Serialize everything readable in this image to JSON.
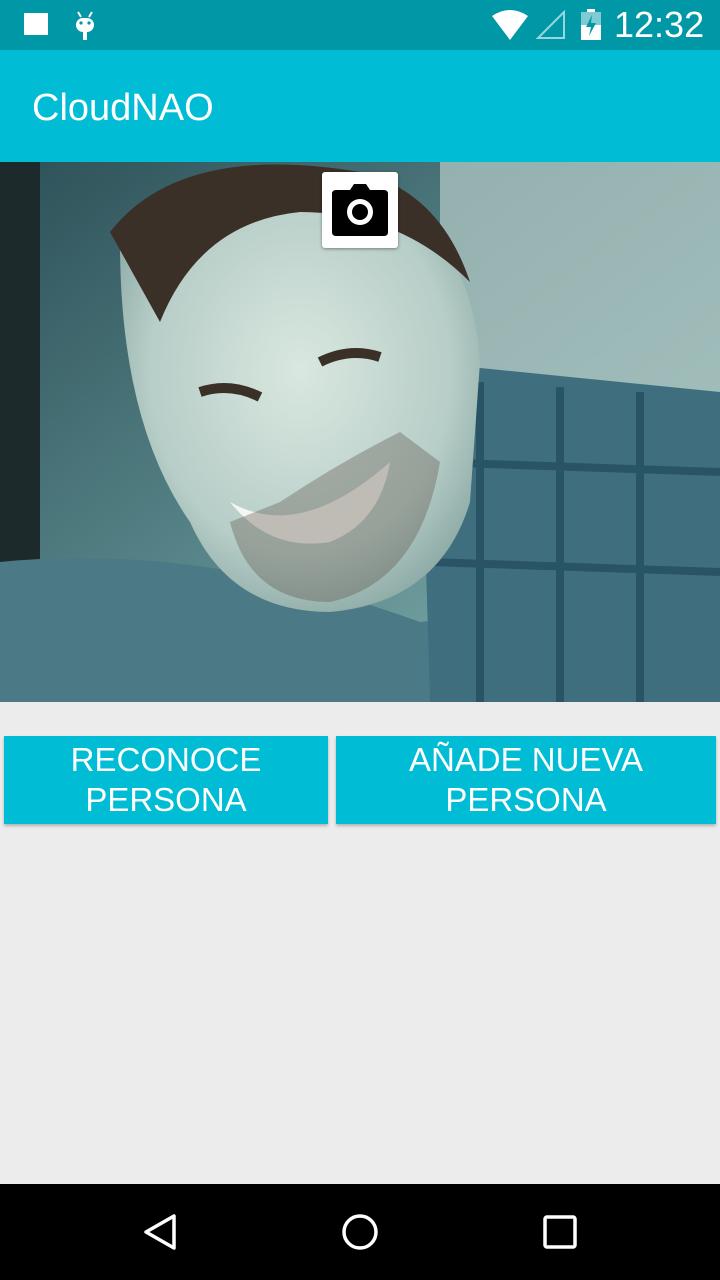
{
  "status_bar": {
    "time": "12:32",
    "icons": [
      "notification-square-icon",
      "android-debug-icon",
      "wifi-icon",
      "cell-signal-icon",
      "battery-charging-icon"
    ]
  },
  "app_bar": {
    "title": "CloudNAO"
  },
  "preview": {
    "description_icon": "camera-icon"
  },
  "buttons": {
    "recognize": "RECONOCE\nPERSONA",
    "add_new": "AÑADE NUEVA\nPERSONA"
  },
  "nav_bar": {
    "icons": [
      "back-icon",
      "home-icon",
      "recents-icon"
    ]
  },
  "colors": {
    "status_bar": "#0097a7",
    "app_bar": "#00bcd4",
    "button": "#00bcd4",
    "background": "#ececec"
  }
}
